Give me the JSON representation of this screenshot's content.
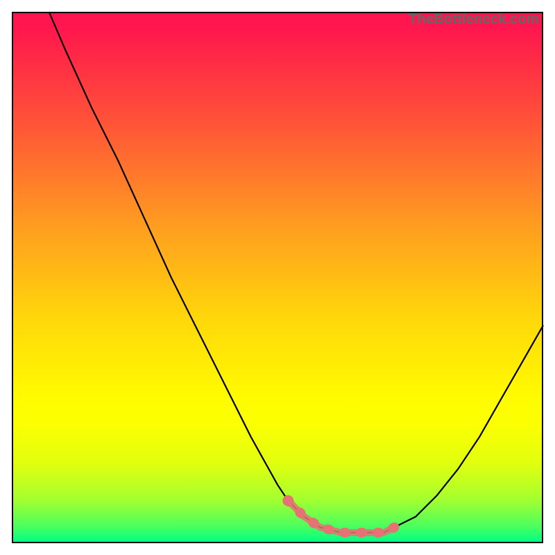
{
  "watermark": "TheBottleneck.com",
  "colors": {
    "curve": "#000000",
    "highlight": "#e57373",
    "border": "#000000"
  },
  "chart_data": {
    "type": "line",
    "title": "",
    "xlabel": "",
    "ylabel": "",
    "xlim": [
      0,
      100
    ],
    "ylim": [
      0,
      100
    ],
    "series": [
      {
        "name": "bottleneck-curve",
        "x": [
          7,
          10,
          15,
          20,
          25,
          30,
          35,
          40,
          45,
          50,
          52,
          55,
          58,
          62,
          66,
          70,
          72,
          76,
          80,
          84,
          88,
          92,
          96,
          100
        ],
        "y": [
          100,
          93,
          82,
          72,
          61,
          50,
          40,
          30,
          20,
          11,
          8,
          5,
          3,
          2,
          2,
          2,
          3,
          5,
          9,
          14,
          20,
          27,
          34,
          41
        ]
      }
    ],
    "highlight": {
      "x": [
        52,
        55,
        58,
        62,
        66,
        70,
        72
      ],
      "y": [
        8,
        5,
        3,
        2,
        2,
        2,
        3
      ]
    }
  }
}
